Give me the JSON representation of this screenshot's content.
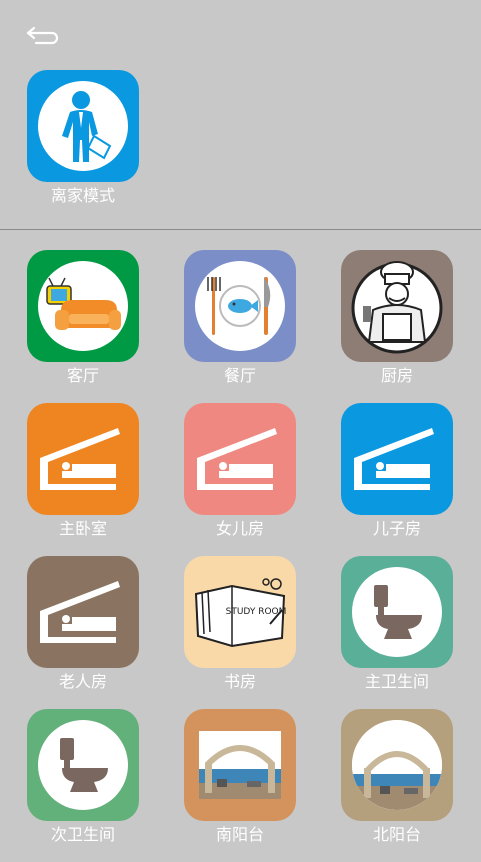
{
  "header": {
    "back_icon": "back-arrow-icon"
  },
  "away_mode": {
    "label": "离家模式",
    "color": "#0a98e0",
    "icon": "walking-man-briefcase-icon"
  },
  "rooms": [
    {
      "label": "客厅",
      "color": "#009a44",
      "icon": "tv-sofa-icon"
    },
    {
      "label": "餐厅",
      "color": "#7b8ec8",
      "icon": "plate-fork-knife-icon"
    },
    {
      "label": "厨房",
      "color": "#8d7d75",
      "icon": "chef-icon"
    },
    {
      "label": "主卧室",
      "color": "#ef8520",
      "icon": "bed-house-icon"
    },
    {
      "label": "女儿房",
      "color": "#ee8880",
      "icon": "bed-house-icon"
    },
    {
      "label": "儿子房",
      "color": "#0a98e0",
      "icon": "bed-house-icon"
    },
    {
      "label": "老人房",
      "color": "#8a7461",
      "icon": "bed-house-icon"
    },
    {
      "label": "书房",
      "color": "#fad9a8",
      "icon": "study-room-book-icon"
    },
    {
      "label": "主卫生间",
      "color": "#5aaf98",
      "icon": "toilet-icon"
    },
    {
      "label": "次卫生间",
      "color": "#62b07a",
      "icon": "toilet-icon"
    },
    {
      "label": "南阳台",
      "color": "#d4935c",
      "icon": "balcony-photo-icon"
    },
    {
      "label": "北阳台",
      "color": "#b5a07e",
      "icon": "balcony-photo-icon"
    }
  ],
  "study_room_sign": "STUDY ROOM"
}
